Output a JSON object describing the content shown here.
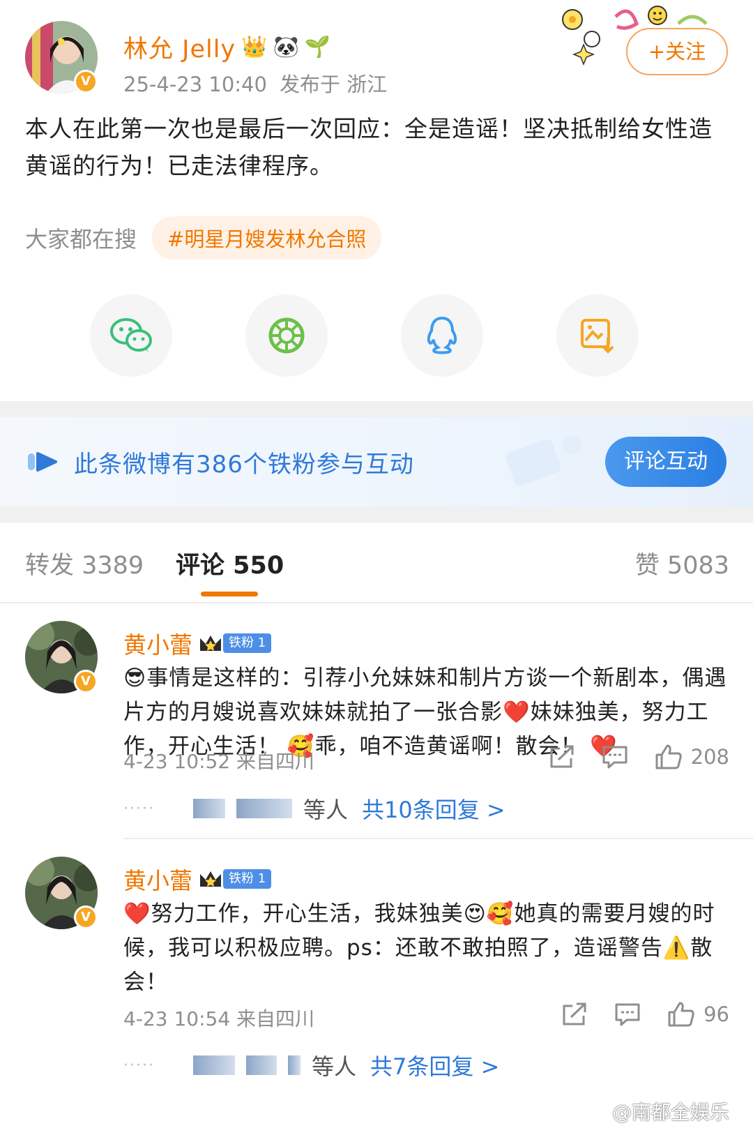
{
  "post": {
    "author_name": "林允 Jelly",
    "author_emojis": [
      "👑",
      "🐼",
      "🌱"
    ],
    "timestamp": "25-4-23 10:40",
    "location": "发布于 浙江",
    "follow_label": "+关注",
    "text": "本人在此第一次也是最后一次回应：全是造谣！坚决抵制给女性造黄谣的行为！已走法律程序。",
    "search_label": "大家都在搜",
    "hashtag": "#明星月嫂发林允合照",
    "share_icons": [
      "wechat-icon",
      "moments-icon",
      "qq-icon",
      "save-image-icon"
    ]
  },
  "banner": {
    "text": "此条微博有386个铁粉参与互动",
    "button_label": "评论互动"
  },
  "tabs": {
    "repost": "转发 3389",
    "comments": "评论 550",
    "likes": "赞 5083"
  },
  "comments": [
    {
      "name": "黄小蕾",
      "badge": "铁粉 1",
      "text": "😎事情是这样的：引荐小允妹妹和制片方谈一个新剧本，偶遇片方的月嫂说喜欢妹妹就拍了一张合影❤️妹妹独美，努力工作，开心生活！ 🥰乖，咱不造黄谣啊！散会！ ❤️",
      "meta": "4-23 10:52 来自四川",
      "likes": "208",
      "reply_dots": "·····",
      "reply_tail": "等人",
      "reply_link": "共10条回复 >"
    },
    {
      "name": "黄小蕾",
      "badge": "铁粉 1",
      "text": "❤️努力工作，开心生活，我妹独美😍🥰她真的需要月嫂的时候，我可以积极应聘。ps：还敢不敢拍照了，造谣警告⚠️散会！",
      "meta": "4-23 10:54 来自四川",
      "likes": "96",
      "reply_dots": "·····",
      "reply_tail": "等人",
      "reply_link": "共7条回复 >"
    }
  ],
  "watermark": "@南都全娱乐",
  "colors": {
    "brand_orange": "#f07700",
    "link_blue": "#2f79d8",
    "muted_gray": "#8e8e8e"
  }
}
